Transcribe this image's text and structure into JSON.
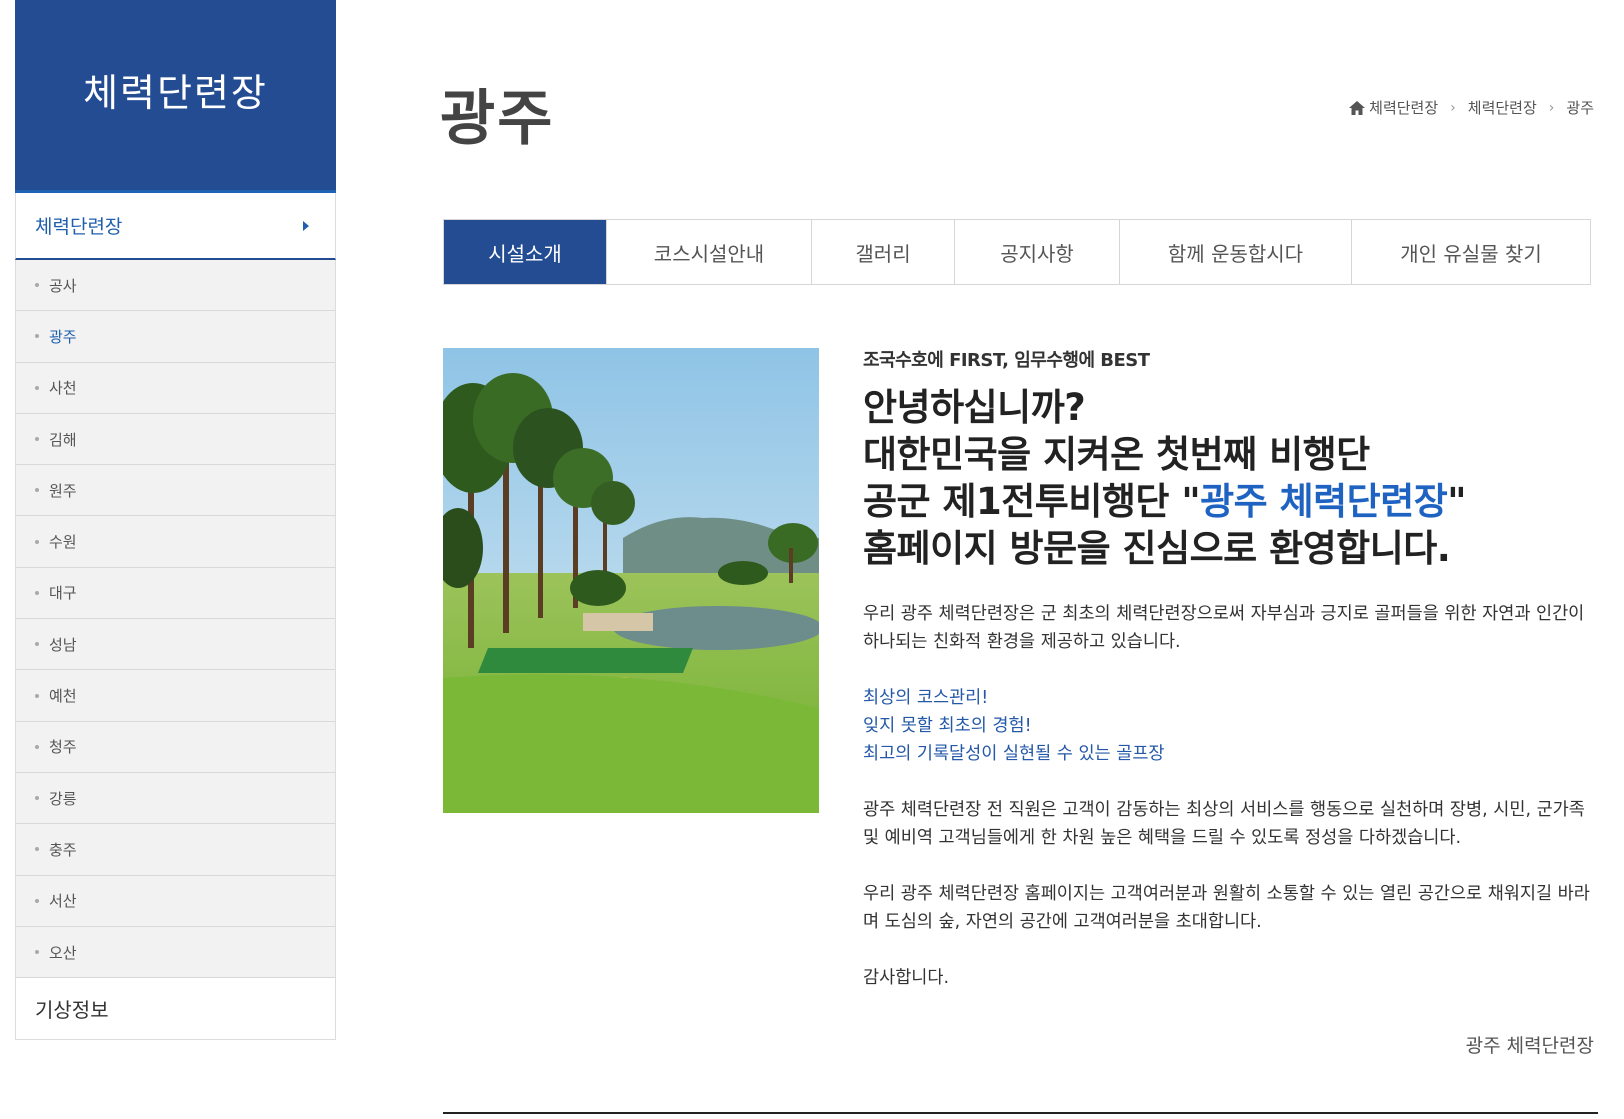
{
  "sidebar": {
    "title": "체력단련장",
    "main_item": "체력단련장",
    "items": [
      {
        "label": "공사",
        "active": false
      },
      {
        "label": "광주",
        "active": true
      },
      {
        "label": "사천",
        "active": false
      },
      {
        "label": "김해",
        "active": false
      },
      {
        "label": "원주",
        "active": false
      },
      {
        "label": "수원",
        "active": false
      },
      {
        "label": "대구",
        "active": false
      },
      {
        "label": "성남",
        "active": false
      },
      {
        "label": "예천",
        "active": false
      },
      {
        "label": "청주",
        "active": false
      },
      {
        "label": "강릉",
        "active": false
      },
      {
        "label": "충주",
        "active": false
      },
      {
        "label": "서산",
        "active": false
      },
      {
        "label": "오산",
        "active": false
      }
    ],
    "weather": "기상정보"
  },
  "header": {
    "title": "광주",
    "breadcrumb": [
      "체력단련장",
      "체력단련장",
      "광주"
    ]
  },
  "tabs": [
    {
      "label": "시설소개",
      "active": true
    },
    {
      "label": "코스시설안내",
      "active": false
    },
    {
      "label": "갤러리",
      "active": false
    },
    {
      "label": "공지사항",
      "active": false
    },
    {
      "label": "함께 운동합시다",
      "active": false
    },
    {
      "label": "개인 유실물 찾기",
      "active": false
    }
  ],
  "content": {
    "slogan": "조국수호에 FIRST, 임무수행에 BEST",
    "greeting": {
      "line1": "안녕하십니까?",
      "line2": "대한민국을 지켜온 첫번째 비행단",
      "line3_prefix": "공군 제1전투비행단 \"",
      "line3_highlight": "광주 체력단련장",
      "line3_suffix": "\"",
      "line4": "홈페이지 방문을 진심으로 환영합니다."
    },
    "para1": "우리 광주 체력단련장은 군 최초의 체력단련장으로써 자부심과 긍지로 골퍼들을 위한 자연과 인간이 하나되는 친화적 환경을 제공하고 있습니다.",
    "highlights": [
      "최상의 코스관리!",
      "잊지 못할 최초의 경험!",
      "최고의 기록달성이 실현될 수 있는 골프장"
    ],
    "para2": "광주 체력단련장 전 직원은 고객이 감동하는 최상의 서비스를 행동으로 실천하며 장병, 시민, 군가족 및 예비역 고객님들에게 한 차원 높은 혜택을 드릴 수 있도록 정성을 다하겠습니다.",
    "para3": "우리 광주 체력단련장 홈페이지는 고객여러분과 원활히 소통할 수 있는 열린 공간으로 채워지길 바라며 도심의 숲, 자연의 공간에 고객여러분을 초대합니다.",
    "thanks": "감사합니다.",
    "signature": "광주 체력단련장"
  },
  "colors": {
    "primary": "#234c93",
    "accent_blue": "#1f63c2",
    "sidebar_bg": "#f2f2f2"
  },
  "icons": [
    "home-icon",
    "chevron-right-icon",
    "caret-right-icon"
  ]
}
